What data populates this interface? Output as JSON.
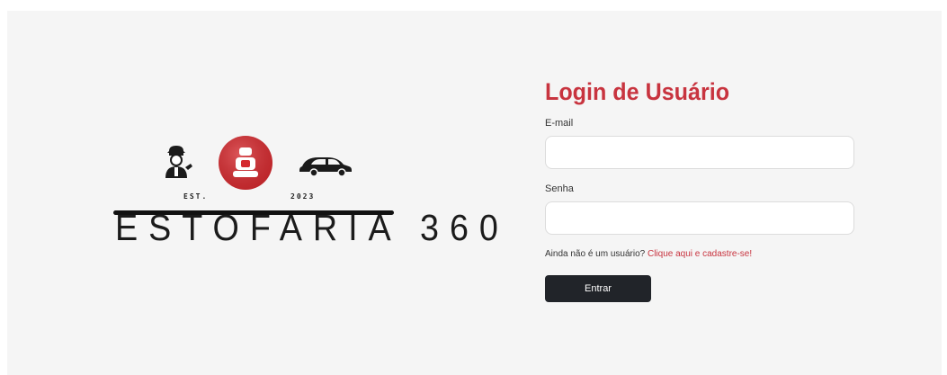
{
  "brand": {
    "name": "ESTOFARIA 360",
    "est_left": "EST.",
    "est_right": "2023",
    "icons": [
      "mechanic-icon",
      "car-seat-icon",
      "car-icon"
    ],
    "colors": {
      "emblem": "#d42a2f",
      "ink": "#1b1b1b"
    }
  },
  "login": {
    "title": "Login de Usuário",
    "email_label": "E-mail",
    "email_value": "",
    "password_label": "Senha",
    "password_value": "",
    "signup_prompt": "Ainda não é um usuário?",
    "signup_link": "Clique aqui e cadastre-se!",
    "submit_label": "Entrar",
    "colors": {
      "accent": "#c8343f",
      "button": "#212429"
    }
  }
}
